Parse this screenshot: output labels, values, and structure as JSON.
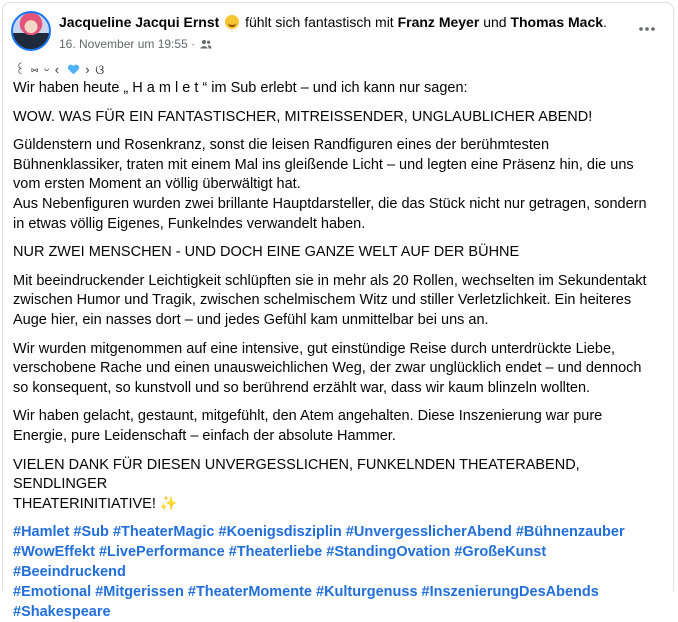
{
  "post": {
    "author": "Jacqueline Jacqui Ernst",
    "feeling_text": "fühlt sich fantastisch mit",
    "tagged_1": "Franz Meyer",
    "and_text": "und",
    "tagged_2": "Thomas Mack",
    "period": ".",
    "timestamp": "16. November um 19:55",
    "separator": "·",
    "audience_icon": "friends-icon",
    "more_icon": "more-dots-icon",
    "deco_left": "꒰ ⑅ ᵕ ‹",
    "deco_right": "›  ଓ",
    "line1": "Wir haben heute „ H a m l e t “ im Sub erlebt – und ich kann nur sagen:",
    "headline": "WOW. WAS FÜR EIN FANTASTISCHER, MITREISSENDER, UNGLAUBLICHER ABEND!",
    "para1_l1": "Güldenstern und Rosenkranz, sonst die leisen Randfiguren eines der berühmtesten",
    "para1_l2": "Bühnenklassiker, traten mit einem Mal ins gleißende Licht – und legten eine Präsenz hin, die uns",
    "para1_l3": "vom ersten Moment an völlig überwältigt hat.",
    "para1_l4": "Aus Nebenfiguren wurden zwei brillante Hauptdarsteller, die das Stück nicht nur getragen, sondern",
    "para1_l5": "in etwas völlig Eigenes, Funkelndes verwandelt haben.",
    "subhead": "NUR ZWEI MENSCHEN - UND DOCH EINE GANZE WELT AUF DER BÜHNE",
    "para2_l1": "Mit beeindruckender Leichtigkeit schlüpften sie in mehr als 20 Rollen, wechselten im Sekundentakt",
    "para2_l2": "zwischen Humor und Tragik, zwischen schelmischem Witz und stiller Verletzlichkeit. Ein heiteres",
    "para2_l3": "Auge hier, ein nasses dort – und jedes Gefühl kam unmittelbar bei uns an.",
    "para3_l1": "Wir wurden mitgenommen auf eine intensive, gut einstündige Reise durch unterdrückte Liebe,",
    "para3_l2": "verschobene Rache und einen unausweichlichen Weg, der zwar unglücklich endet – und dennoch",
    "para3_l3": "so konsequent, so kunstvoll und so berührend erzählt war, dass wir kaum blinzeln wollten.",
    "para4_l1": "Wir haben gelacht, gestaunt, mitgefühlt, den Atem angehalten. Diese Inszenierung war pure",
    "para4_l2": "Energie, pure Leidenschaft – einfach der absolute Hammer.",
    "thanks_l1": "VIELEN DANK FÜR DIESEN UNVERGESSLICHEN, FUNKELNDEN THEATERABEND, SENDLINGER",
    "thanks_l2": "THEATERINITIATIVE!",
    "sparkle": "✨",
    "hashtags": [
      "#Hamlet",
      "#Sub",
      "#TheaterMagic",
      "#Koenigsdisziplin",
      "#UnvergesslicherAbend",
      "#Bühnenzauber",
      "#WowEffekt",
      "#LivePerformance",
      "#Theaterliebe",
      "#StandingOvation",
      "#GroßeKunst",
      "#Beeindruckend",
      "#Emotional",
      "#Mitgerissen",
      "#TheaterMomente",
      "#Kulturgenuss",
      "#InszenierungDesAbends",
      "#Shakespeare"
    ]
  },
  "colors": {
    "text": "#050505",
    "muted": "#65676b",
    "link": "#216fdb",
    "border": "#dddfe2",
    "avatar_ring": "#1877f2"
  }
}
